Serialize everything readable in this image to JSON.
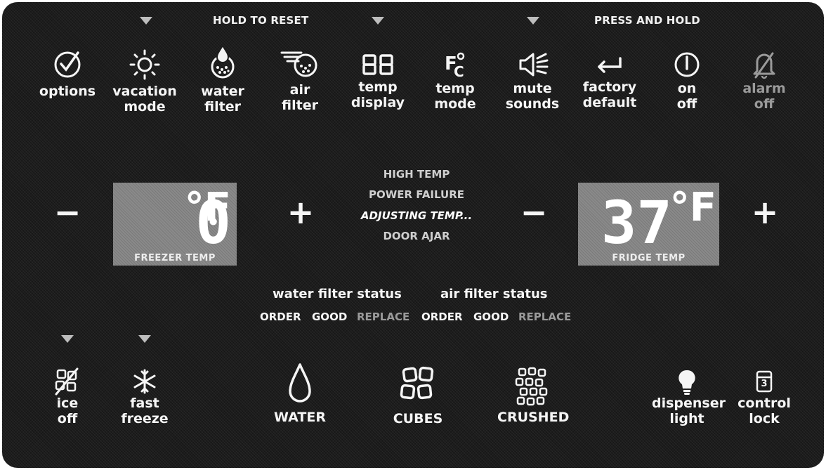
{
  "header": {
    "hold_to_reset": "HOLD TO RESET",
    "press_and_hold": "PRESS AND HOLD"
  },
  "top_buttons": [
    {
      "line1": "options",
      "line2": "",
      "icon": "check-circle-icon"
    },
    {
      "line1": "vacation",
      "line2": "mode",
      "icon": "sun-icon"
    },
    {
      "line1": "water",
      "line2": "filter",
      "icon": "water-filter-icon"
    },
    {
      "line1": "air",
      "line2": "filter",
      "icon": "air-filter-icon"
    },
    {
      "line1": "temp",
      "line2": "display",
      "icon": "digit-88-icon"
    },
    {
      "line1": "temp",
      "line2": "mode",
      "icon": "fahrenheit-celsius-icon"
    },
    {
      "line1": "mute",
      "line2": "sounds",
      "icon": "speaker-mute-icon"
    },
    {
      "line1": "factory",
      "line2": "default",
      "icon": "return-arrow-icon"
    },
    {
      "line1": "on",
      "line2": "off",
      "icon": "power-icon"
    },
    {
      "line1": "alarm",
      "line2": "off",
      "icon": "bell-off-icon"
    }
  ],
  "freezer": {
    "value": "0",
    "unit": "°F",
    "label": "FREEZER TEMP",
    "minus": "−",
    "plus": "+"
  },
  "fridge": {
    "value": "37",
    "unit": "°F",
    "label": "FRIDGE TEMP",
    "minus": "−",
    "plus": "+"
  },
  "alerts": [
    "HIGH TEMP",
    "POWER FAILURE",
    "ADJUSTING TEMP...",
    "DOOR AJAR"
  ],
  "water_filter_status": {
    "title": "water filter status",
    "order": "ORDER",
    "good": "GOOD",
    "replace": "REPLACE"
  },
  "air_filter_status": {
    "title": "air filter status",
    "order": "ORDER",
    "good": "GOOD",
    "replace": "REPLACE"
  },
  "bottom_buttons": {
    "ice_off": {
      "line1": "ice",
      "line2": "off",
      "icon": "ice-off-icon"
    },
    "fast_freeze": {
      "line1": "fast",
      "line2": "freeze",
      "icon": "snowflake-icon"
    },
    "water": {
      "label": "WATER",
      "icon": "water-drop-icon"
    },
    "cubes": {
      "label": "CUBES",
      "icon": "ice-cubes-icon"
    },
    "crushed": {
      "label": "CRUSHED",
      "icon": "crushed-ice-icon"
    },
    "dispenser_light": {
      "line1": "dispenser",
      "line2": "light",
      "icon": "light-bulb-icon"
    },
    "control_lock": {
      "line1": "control",
      "line2": "lock",
      "icon": "lock-icon",
      "icon_text": "3"
    }
  },
  "colors": {
    "panel": "#1c1c1c",
    "text": "#f5f5f5",
    "dim": "#9a9a9a",
    "lcd": "#8a8a8a"
  }
}
